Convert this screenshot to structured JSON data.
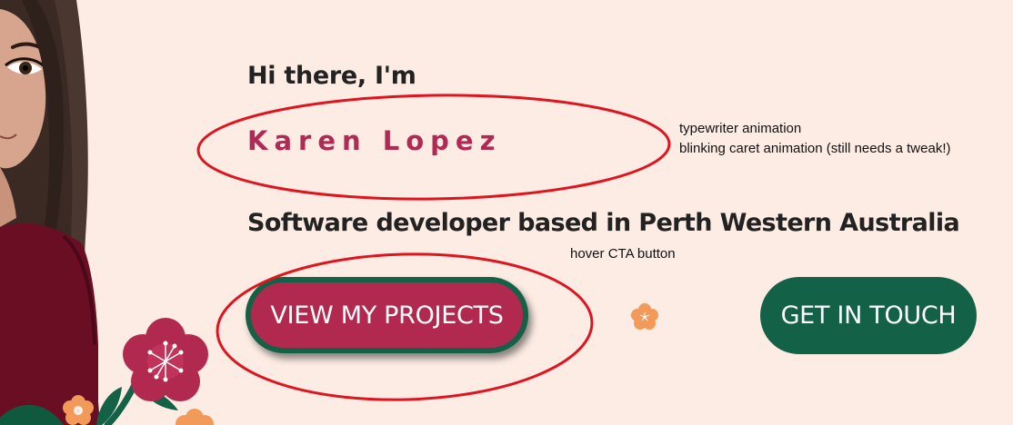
{
  "hero": {
    "greeting": "Hi there, I'm",
    "name": "Karen Lopez",
    "tagline": "Software developer based in Perth Western Australia"
  },
  "cta": {
    "projects_label": "VIEW MY PROJECTS",
    "contact_label": "GET IN TOUCH"
  },
  "annotations": {
    "note_typewriter": "typewriter animation",
    "note_caret": "blinking caret animation (still needs a tweak!)",
    "note_hover": "hover CTA button"
  },
  "colors": {
    "background": "#fdece4",
    "name_accent": "#b02a55",
    "primary_button": "#b2294f",
    "secondary_button": "#136147",
    "annotation_red": "#e0141e",
    "flower_orange": "#f29a5a"
  },
  "icons": [
    "avatar-illustration",
    "flower-icon",
    "small-blossom-icon"
  ]
}
